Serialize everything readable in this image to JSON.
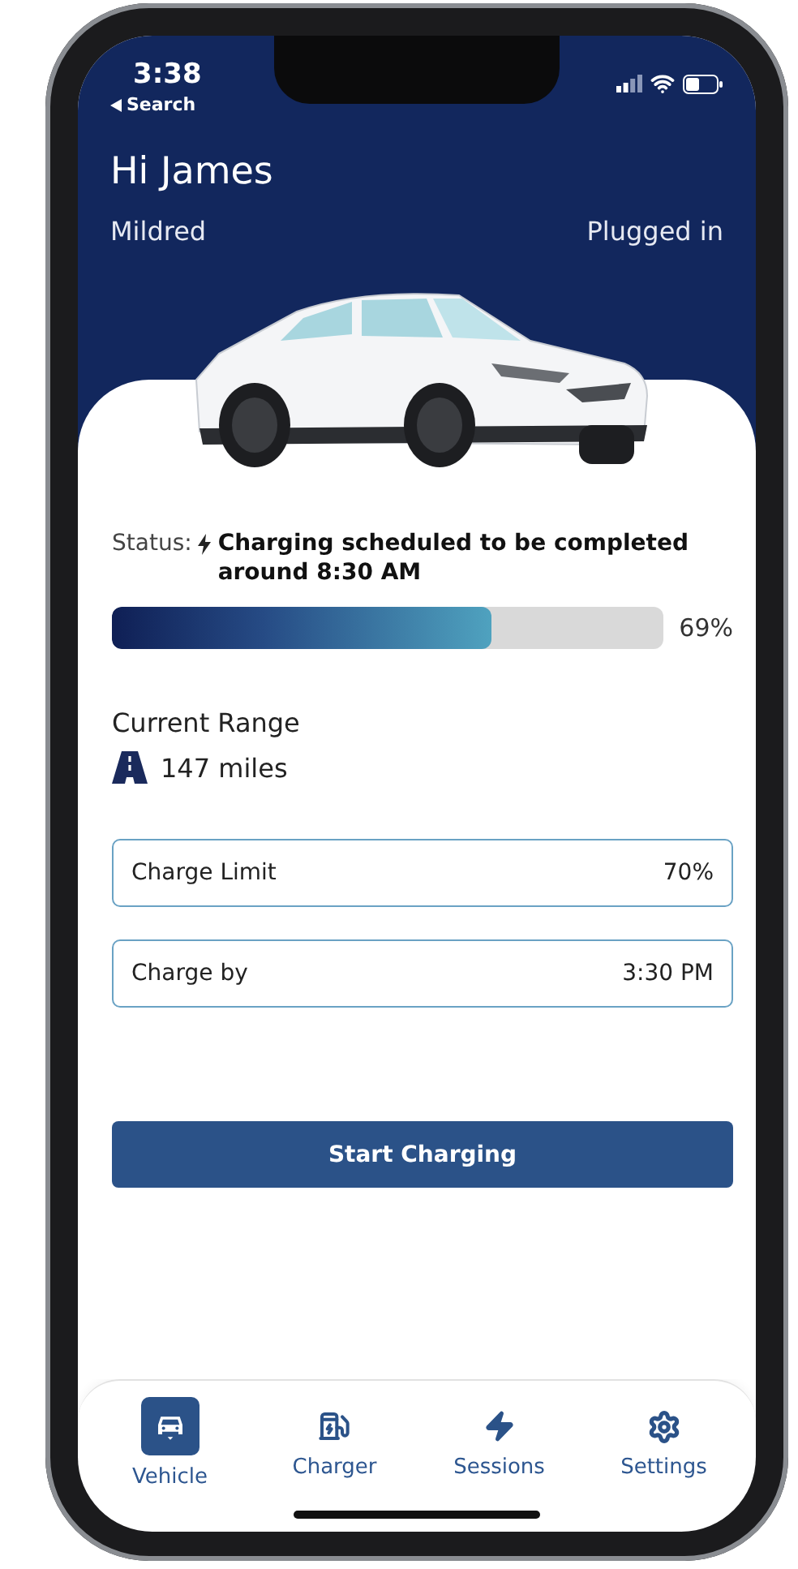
{
  "status_bar": {
    "time": "3:38",
    "back_label": "Search"
  },
  "header": {
    "greeting": "Hi James",
    "vehicle_name": "Mildred",
    "connection": "Plugged in"
  },
  "charge_status": {
    "label": "Status:",
    "message": "Charging scheduled to be completed around 8:30 AM",
    "level": 0.69,
    "reading": "69%"
  },
  "range": {
    "label": "Current Range",
    "value": "147 miles"
  },
  "fields": [
    {
      "label": "Charge Limit",
      "value": "70%"
    },
    {
      "label": "Charge by",
      "value": "3:30 PM"
    }
  ],
  "button": "Start Charging",
  "tabs": [
    {
      "kind": "vehicle",
      "label": "Vehicle",
      "selected": true
    },
    {
      "kind": "charger",
      "label": "Charger",
      "selected": false
    },
    {
      "kind": "sessions",
      "label": "Sessions",
      "selected": false
    },
    {
      "kind": "settings",
      "label": "Settings",
      "selected": false
    }
  ]
}
